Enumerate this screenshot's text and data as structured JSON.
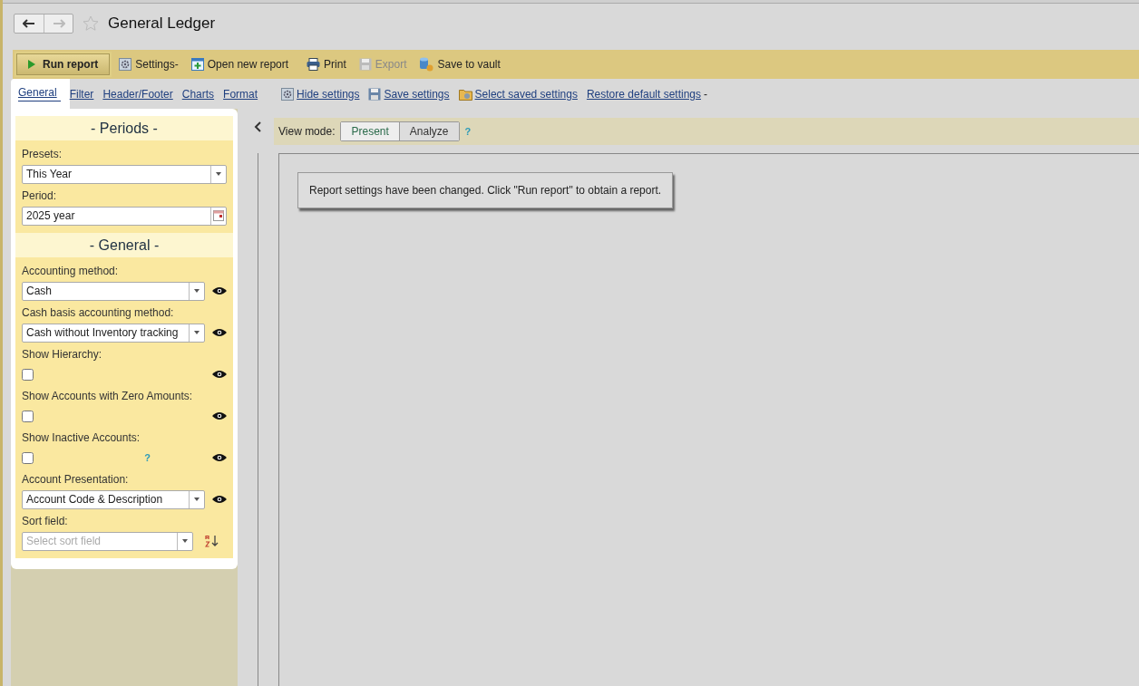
{
  "header": {
    "title": "General Ledger",
    "favorite": false,
    "back_disabled": false,
    "forward_disabled": true
  },
  "toolbar": {
    "run_button": "Run report",
    "items": [
      {
        "kind": "gear",
        "label": "Settings",
        "suffix": "-",
        "disabled": false
      },
      {
        "kind": "new",
        "label": "Open new report",
        "disabled": false
      },
      {
        "kind": "print",
        "label": "Print",
        "disabled": false
      },
      {
        "kind": "save",
        "label": "Export",
        "disabled": true
      },
      {
        "kind": "vault",
        "label": "Save to vault",
        "disabled": false
      }
    ]
  },
  "tabs": [
    {
      "label": "General",
      "selected": true
    },
    {
      "label": "Filter",
      "selected": false
    },
    {
      "label": "Header/Footer",
      "selected": false
    },
    {
      "label": "Charts",
      "selected": false
    },
    {
      "label": "Format",
      "selected": false
    }
  ],
  "actions": [
    {
      "kind": "gear",
      "label": "Hide settings"
    },
    {
      "kind": "save",
      "label": "Save settings"
    },
    {
      "kind": "folder",
      "label": "Select saved settings"
    },
    {
      "kind": "none",
      "label": "Restore default settings",
      "suffix": "-"
    }
  ],
  "sections": [
    {
      "title": "- Periods -",
      "fields": [
        {
          "kind": "select",
          "label": "Presets:",
          "value": "This Year"
        },
        {
          "kind": "date",
          "label": "Period:",
          "value": "2025 year"
        }
      ]
    },
    {
      "title": "- General -",
      "fields": [
        {
          "kind": "select",
          "label": "Accounting method:",
          "value": "Cash",
          "eye": true
        },
        {
          "kind": "select",
          "label": "Cash basis accounting method:",
          "value": "Cash without Inventory tracking",
          "eye": true
        },
        {
          "kind": "checkbox",
          "label": "Show Hierarchy:",
          "checked": false,
          "eye": true
        },
        {
          "kind": "checkbox",
          "label": "Show Accounts with Zero Amounts:",
          "checked": false,
          "eye": true
        },
        {
          "kind": "checkbox",
          "label": "Show Inactive Accounts:",
          "checked": false,
          "help": "?",
          "eye": true
        },
        {
          "kind": "select",
          "label": "Account Presentation:",
          "value": "Account Code & Description",
          "eye": true
        },
        {
          "kind": "sort",
          "label": "Sort field:",
          "placeholder": "Select sort field"
        }
      ]
    }
  ],
  "view_mode": {
    "label": "View mode:",
    "options": [
      {
        "label": "Present",
        "selected": true
      },
      {
        "label": "Analyze",
        "selected": false
      }
    ],
    "help": "?"
  },
  "message": "Report settings have been changed. Click \"Run report\" to obtain a report."
}
